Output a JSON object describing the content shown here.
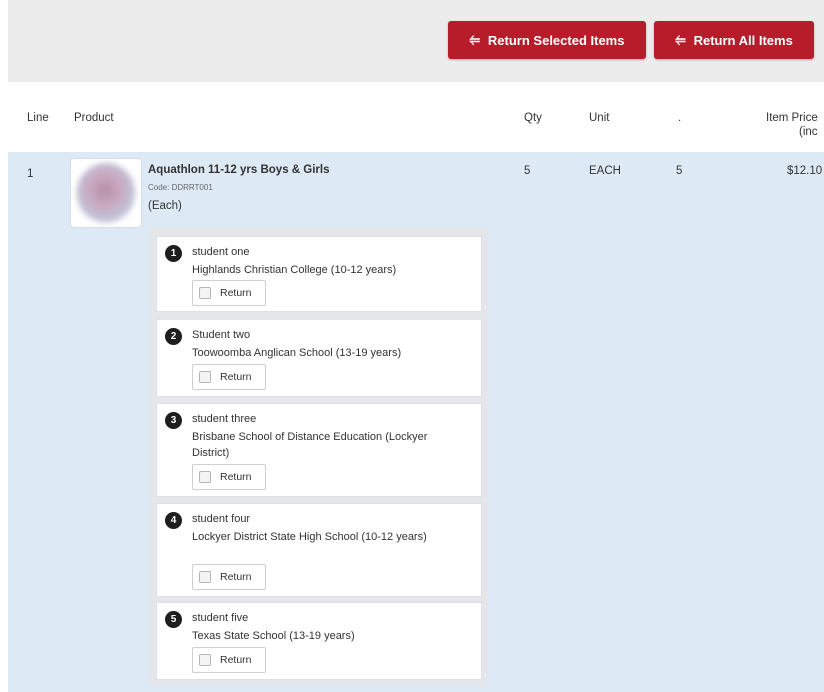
{
  "toolbar": {
    "return_selected_label": "Return Selected Items",
    "return_all_label": "Return All Items",
    "return_icon": "⥢"
  },
  "table": {
    "headers": {
      "line": "Line",
      "product": "Product",
      "qty": "Qty",
      "unit": "Unit",
      "dot": ".",
      "item_price_1": "Item Price",
      "item_price_2": "(inc"
    },
    "row": {
      "line": "1",
      "product_name": "Aquathlon 11-12 yrs Boys & Girls",
      "code": "Code: DDRRT001",
      "unit_note": "(Each)",
      "qty": "5",
      "unit": "EACH",
      "dot_value": "5",
      "price": "$12.10"
    }
  },
  "students": [
    {
      "number": "1",
      "name": "student one",
      "school": "Highlands Christian College (10-12 years)",
      "return_label": "Return"
    },
    {
      "number": "2",
      "name": "Student two",
      "school": "Toowoomba Anglican School (13-19 years)",
      "return_label": "Return"
    },
    {
      "number": "3",
      "name": "student three",
      "school": "Brisbane School of Distance Education (Lockyer District)",
      "return_label": "Return"
    },
    {
      "number": "4",
      "name": "student four",
      "school": "Lockyer District State High School (10-12 years)",
      "return_label": "Return"
    },
    {
      "number": "5",
      "name": "student five",
      "school": "Texas State School (13-19 years)",
      "return_label": "Return"
    }
  ],
  "colors": {
    "accent": "#b71c2a",
    "row_bg": "#dde9f4",
    "toolbar_bg": "#ececec"
  }
}
